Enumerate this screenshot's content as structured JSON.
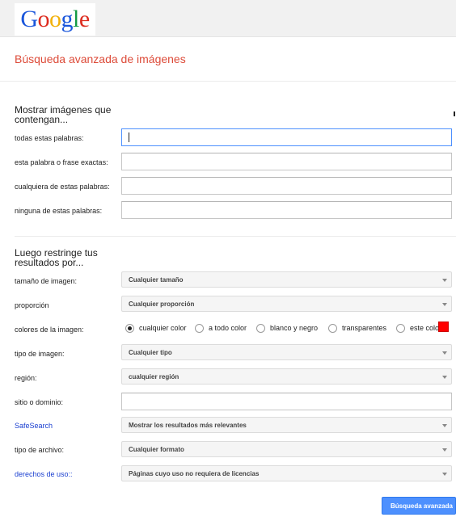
{
  "header": {
    "logo_letters": [
      {
        "char": "G",
        "color": "#1a56db"
      },
      {
        "char": "o",
        "color": "#dd2c1f"
      },
      {
        "char": "o",
        "color": "#f2b10a"
      },
      {
        "char": "g",
        "color": "#1a56db"
      },
      {
        "char": "l",
        "color": "#139a43"
      },
      {
        "char": "e",
        "color": "#dd2c1f"
      }
    ]
  },
  "page": {
    "title": "Búsqueda avanzada de imágenes"
  },
  "section1": {
    "heading_line1": "Mostrar imágenes que",
    "heading_line2": "contengan...",
    "fields": [
      {
        "label": "todas estas palabras:",
        "value": ""
      },
      {
        "label": "esta palabra o frase exactas:",
        "value": ""
      },
      {
        "label": "cualquiera de estas palabras:",
        "value": ""
      },
      {
        "label": "ninguna de estas palabras:",
        "value": ""
      }
    ]
  },
  "section2": {
    "heading_line1": "Luego restringe tus",
    "heading_line2": "resultados por...",
    "size": {
      "label": "tamaño de imagen:",
      "value": "Cualquier tamaño"
    },
    "aspect": {
      "label": "proporción",
      "value": "Cualquier proporción"
    },
    "colors": {
      "label": "colores de la imagen:",
      "options": [
        "cualquier color",
        "a todo color",
        "blanco y negro",
        "transparentes",
        "este colo"
      ],
      "selected_index": 0,
      "swatch_color": "#ff0000"
    },
    "type": {
      "label": "tipo de imagen:",
      "value": "Cualquier tipo"
    },
    "region": {
      "label": "región:",
      "value": "cualquier región"
    },
    "site": {
      "label": "sitio o dominio:",
      "value": ""
    },
    "safesearch": {
      "label": "SafeSearch",
      "value": "Mostrar los resultados más relevantes"
    },
    "filetype": {
      "label": "tipo de archivo:",
      "value": "Cualquier formato"
    },
    "rights": {
      "label": "derechos de uso::",
      "value": "Páginas cuyo uso no requiera de licencias"
    }
  },
  "submit_label": "Búsqueda avanzada",
  "colors": {
    "accent_blue": "#4d90fe",
    "title_red": "#dd4b39",
    "link_blue": "#1a3fd0"
  }
}
